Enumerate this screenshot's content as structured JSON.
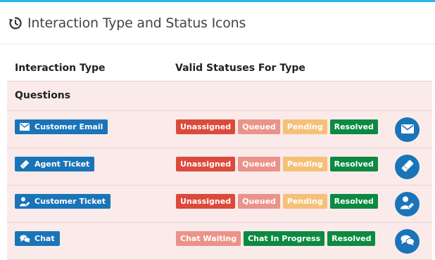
{
  "panel": {
    "title": "Interaction Type and Status Icons",
    "header_icon": "history-icon",
    "accent_color": "#29b6e8"
  },
  "table": {
    "columns": [
      "Interaction Type",
      "Valid Statuses For Type"
    ],
    "group_label": "Questions",
    "rows": [
      {
        "type_label": "Customer Email",
        "icon": "envelope-icon",
        "statuses": [
          "Unassigned",
          "Queued",
          "Pending",
          "Resolved"
        ]
      },
      {
        "type_label": "Agent Ticket",
        "icon": "ticket-icon",
        "statuses": [
          "Unassigned",
          "Queued",
          "Pending",
          "Resolved"
        ]
      },
      {
        "type_label": "Customer Ticket",
        "icon": "user-ticket-icon",
        "statuses": [
          "Unassigned",
          "Queued",
          "Pending",
          "Resolved"
        ]
      },
      {
        "type_label": "Chat",
        "icon": "chat-bubbles-icon",
        "statuses": [
          "Chat Waiting",
          "Chat In Progress",
          "Resolved"
        ]
      }
    ]
  },
  "colors": {
    "type_badge": "#1a74b8",
    "unassigned": "#dc4a3b",
    "queued": "#ea938a",
    "pending": "#f5c078",
    "resolved": "#0d8a42",
    "row_background": "#fbeaea"
  }
}
